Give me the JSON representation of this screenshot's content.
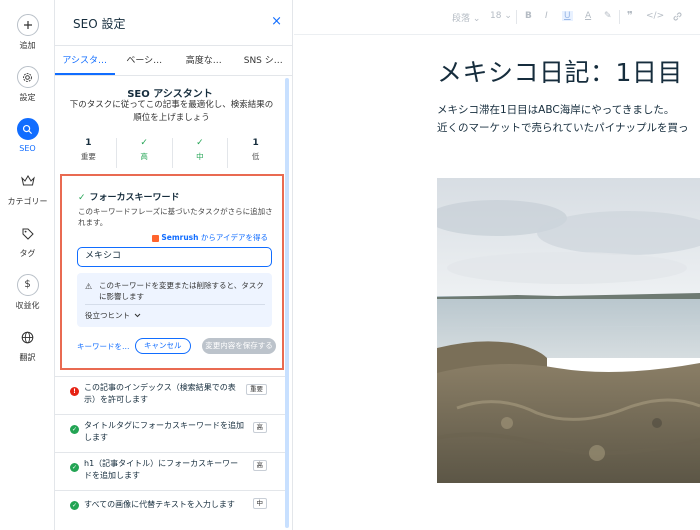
{
  "rail": {
    "items": [
      {
        "label": "追加"
      },
      {
        "label": "設定"
      },
      {
        "label": "SEO"
      },
      {
        "label": "カテゴリー"
      },
      {
        "label": "タグ"
      },
      {
        "label": "収益化"
      },
      {
        "label": "翻訳"
      }
    ]
  },
  "panel": {
    "title": "SEO 設定",
    "close": "×",
    "tabs": [
      "アシスタ…",
      "ベーシ…",
      "高度な…",
      "SNS シ…"
    ],
    "assistant": {
      "title": "SEO アシスタント",
      "description": "下のタスクに従ってこの記事を最適化し、検索結果の順位を上げましょう"
    },
    "counts": [
      {
        "value": "1",
        "label": "重要"
      },
      {
        "value": "✓",
        "label": "高"
      },
      {
        "value": "✓",
        "label": "中"
      },
      {
        "value": "1",
        "label": "低"
      }
    ],
    "focus": {
      "title": "フォーカスキーワード",
      "description": "このキーワードフレーズに基づいたタスクがさらに追加されます。",
      "semrush_brand": "Semrush",
      "semrush_link": "からアイデアを得る",
      "keyword_value": "メキシコ",
      "notice": "このキーワードを変更または削除すると、タスクに影響します",
      "hint": "役立つヒント",
      "keyword_link": "キーワードを…",
      "cancel": "キャンセル",
      "save": "変更内容を保存する"
    },
    "tasks": [
      {
        "text": "この記事のインデックス（検索結果での表示）を許可します",
        "badge": "重要",
        "status": "error"
      },
      {
        "text": "タイトルタグにフォーカスキーワードを追加します",
        "badge": "高",
        "status": "done"
      },
      {
        "text": "h1（記事タイトル）にフォーカスキーワードを追加します",
        "badge": "高",
        "status": "done"
      },
      {
        "text": "すべての画像に代替テキストを入力します",
        "badge": "中",
        "status": "done"
      }
    ]
  },
  "toolbar": {
    "paragraph": "段落",
    "font_size": "18",
    "bold": "B",
    "italic": "I",
    "underline": "U",
    "color": "A",
    "highlight": "✎",
    "quote": "❞",
    "code": "</>"
  },
  "document": {
    "title": "メキシコ日記：1日目",
    "lines": [
      "メキシコ滞在1日目はABC海岸にやってきました。",
      "近くのマーケットで売られていたパイナップルを買っ"
    ]
  },
  "colors": {
    "accent": "#116dff",
    "highlight_border": "#e96a51",
    "success": "#23a454",
    "error": "#e62214"
  }
}
